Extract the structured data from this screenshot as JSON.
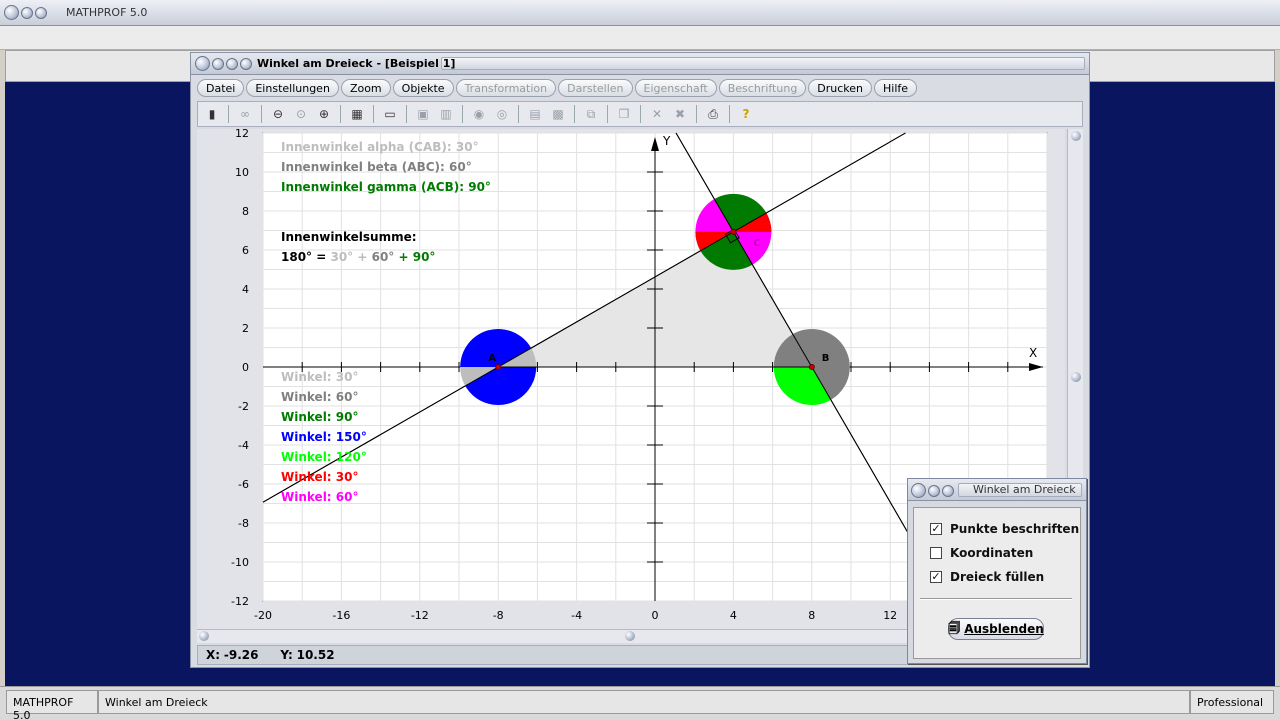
{
  "app": {
    "title": "MATHPROF 5.0",
    "status": {
      "left": "MATHPROF 5.0",
      "middle": "Winkel am Dreieck",
      "right": "Professional"
    }
  },
  "window": {
    "title": "Winkel am Dreieck - [Beispiel 1]",
    "menus": [
      {
        "label": "Datei",
        "enabled": true
      },
      {
        "label": "Einstellungen",
        "enabled": true
      },
      {
        "label": "Zoom",
        "enabled": true
      },
      {
        "label": "Objekte",
        "enabled": true
      },
      {
        "label": "Transformation",
        "enabled": false
      },
      {
        "label": "Darstellen",
        "enabled": false
      },
      {
        "label": "Eigenschaft",
        "enabled": false
      },
      {
        "label": "Beschriftung",
        "enabled": false
      },
      {
        "label": "Drucken",
        "enabled": true
      },
      {
        "label": "Hilfe",
        "enabled": true
      }
    ],
    "coords": {
      "x_label": "X:",
      "x_value": "-9.26",
      "y_label": "Y:",
      "y_value": "10.52"
    }
  },
  "plot": {
    "x_axis_label": "X",
    "y_axis_label": "Y",
    "xlim": [
      -20,
      20
    ],
    "ylim": [
      -12,
      12
    ],
    "x_ticks": [
      "-20",
      "-16",
      "-12",
      "-8",
      "-4",
      "0",
      "4",
      "8",
      "12"
    ],
    "y_ticks": [
      "12",
      "10",
      "8",
      "6",
      "4",
      "2",
      "0",
      "-2",
      "-4",
      "-6",
      "-8",
      "-10",
      "-12"
    ],
    "points": [
      {
        "label": "A",
        "x": -8,
        "y": 0
      },
      {
        "label": "B",
        "x": 8,
        "y": 0
      },
      {
        "label": "C",
        "x": 4,
        "y": 6.93
      }
    ],
    "info_top": [
      {
        "text": "Innenwinkel alpha (CAB): 30°",
        "color": "#bdbdbd"
      },
      {
        "text": "Innenwinkel beta (ABC): 60°",
        "color": "#808080"
      },
      {
        "text": "Innenwinkel gamma (ACB): 90°",
        "color": "#007a00"
      }
    ],
    "sum": {
      "title": "Innenwinkelsumme:",
      "total": "180°",
      "eq": "=",
      "a": "30°",
      "plus1": "+",
      "b": "60°",
      "plus2": "+",
      "c": "90°"
    },
    "angles": [
      {
        "text": "Winkel: 30°",
        "color": "#bdbdbd"
      },
      {
        "text": "Winkel: 60°",
        "color": "#808080"
      },
      {
        "text": "Winkel: 90°",
        "color": "#007a00"
      },
      {
        "text": "Winkel: 150°",
        "color": "#0000ff"
      },
      {
        "text": "Winkel: 120°",
        "color": "#00ff00"
      },
      {
        "text": "Winkel: 30°",
        "color": "#ff0000"
      },
      {
        "text": "Winkel: 60°",
        "color": "#ff00ff"
      }
    ]
  },
  "dialog": {
    "title": "Winkel am Dreieck",
    "options": [
      {
        "label": "Punkte beschriften",
        "checked": true
      },
      {
        "label": "Koordinaten",
        "checked": false
      },
      {
        "label": "Dreieck füllen",
        "checked": true
      }
    ],
    "button": "Ausblenden"
  }
}
